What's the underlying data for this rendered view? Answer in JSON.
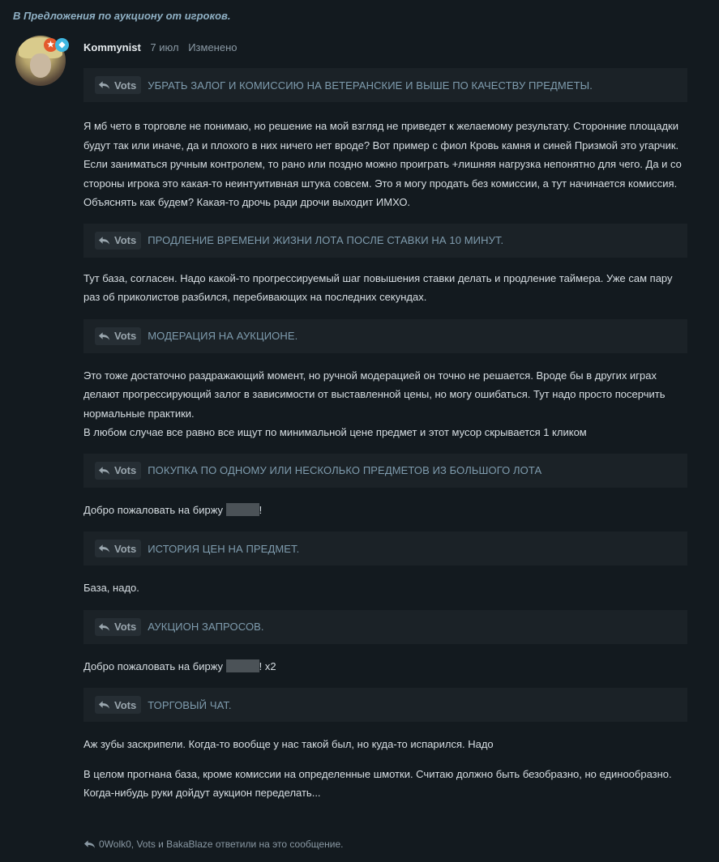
{
  "breadcrumb": "В Предложения по аукциону от игроков.",
  "post": {
    "author": "Kommynist",
    "date": "7 июл",
    "edited": "Изменено",
    "avatar_icon": "avatar-image",
    "badges": [
      "trophy-icon",
      "diamond-icon"
    ]
  },
  "blocks": [
    {
      "quote": {
        "author": "Vots",
        "text": "УБРАТЬ ЗАЛОГ И КОМИССИЮ НА ВЕТЕРАНСКИЕ И ВЫШЕ ПО КАЧЕСТВУ ПРЕДМЕТЫ."
      },
      "paragraphs": [
        "Я мб чето в торговле не понимаю, но решение на мой взгляд не приведет к желаемому результату. Сторонние площадки будут так или иначе, да и плохого в них ничего нет вроде? Вот пример с фиол Кровь камня и синей Призмой это угарчик. Если заниматься ручным контролем, то рано или поздно можно проиграть +лишняя нагрузка непонятно для чего. Да и со стороны игрока это какая-то неинтуитивная штука совсем. Это я могу продать без комиссии, а тут начинается комиссия. Объяснять как будем? Какая-то дрочь ради дрочи выходит ИМХО."
      ]
    },
    {
      "quote": {
        "author": "Vots",
        "text": "ПРОДЛЕНИЕ ВРЕМЕНИ ЖИЗНИ ЛОТА ПОСЛЕ СТАВКИ НА 10 МИНУТ."
      },
      "paragraphs": [
        "Тут база, согласен. Надо какой-то прогрессируемый шаг повышения ставки делать и продление таймера. Уже сам пару раз об приколистов разбился, перебивающих на последних секундах."
      ]
    },
    {
      "quote": {
        "author": "Vots",
        "text": "МОДЕРАЦИЯ НА АУКЦИОНЕ."
      },
      "paragraphs": [
        "Это тоже достаточно раздражающий момент, но ручной модерацией он точно не решается. Вроде бы в других играх делают прогрессирующий залог в зависимости от выставленной цены, но могу ошибаться. Тут надо просто посерчить нормальные практики.",
        "В любом случае все равно все ищут по минимальной цене предмет и этот мусор скрывается 1 кликом"
      ]
    },
    {
      "quote": {
        "author": "Vots",
        "text": "ПОКУПКА ПО ОДНОМУ ИЛИ НЕСКОЛЬКО ПРЕДМЕТОВ ИЗ БОЛЬШОГО ЛОТА"
      },
      "welcome": {
        "before": "Добро пожаловать на биржу ",
        "after": "!"
      }
    },
    {
      "quote": {
        "author": "Vots",
        "text": "ИСТОРИЯ ЦЕН НА ПРЕДМЕТ."
      },
      "paragraphs": [
        "База, надо."
      ]
    },
    {
      "quote": {
        "author": "Vots",
        "text": "АУКЦИОН ЗАПРОСОВ."
      },
      "welcome": {
        "before": "Добро пожаловать на биржу ",
        "after": "! x2"
      }
    },
    {
      "quote": {
        "author": "Vots",
        "text": "ТОРГОВЫЙ ЧАТ."
      },
      "paragraphs": [
        "Аж зубы заскрипели. Когда-то вообще у нас такой был, но куда-то испарился. Надо"
      ]
    }
  ],
  "closing": "В целом прогнана база, кроме комиссии на определенные шмотки. Считаю должно быть безобразно, но единообразно. Когда-нибудь руки дойдут аукцион переделать...",
  "footer": "0Wolk0, Vots и BakaBlaze ответили на это сообщение."
}
